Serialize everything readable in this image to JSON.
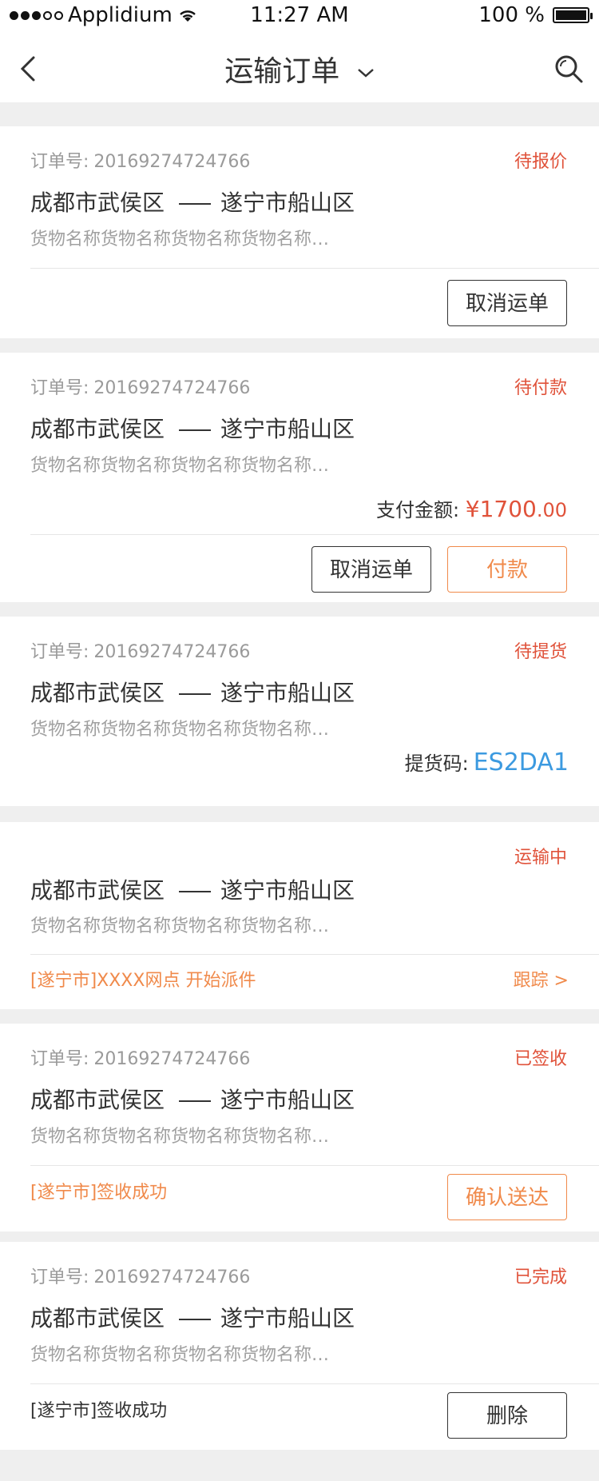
{
  "status_bar": {
    "carrier": "Applidium",
    "time": "11:27 AM",
    "battery": "100 %"
  },
  "nav": {
    "title": "运输订单"
  },
  "order_label": "订单号:",
  "orders": [
    {
      "order_no": "20169274724766",
      "status": "待报价",
      "route_from": "成都市武侯区",
      "route_to": "遂宁市船山区",
      "goods": "货物名称货物名称货物名称货物名称…",
      "buttons": {
        "cancel": "取消运单"
      }
    },
    {
      "order_no": "20169274724766",
      "status": "待付款",
      "route_from": "成都市武侯区",
      "route_to": "遂宁市船山区",
      "goods": "货物名称货物名称货物名称货物名称…",
      "amount_label": "支付金额:",
      "amount_int": "¥1700",
      "amount_dec": ".00",
      "buttons": {
        "cancel": "取消运单",
        "pay": "付款"
      }
    },
    {
      "order_no": "20169274724766",
      "status": "待提货",
      "route_from": "成都市武侯区",
      "route_to": "遂宁市船山区",
      "goods": "货物名称货物名称货物名称货物名称…",
      "pickup_label": "提货码:",
      "pickup_code": "ES2DA1"
    },
    {
      "status": "运输中",
      "route_from": "成都市武侯区",
      "route_to": "遂宁市船山区",
      "goods": "货物名称货物名称货物名称货物名称…",
      "tracking_text": "[遂宁市]XXXX网点 开始派件",
      "tracking_link": "跟踪 >"
    },
    {
      "order_no": "20169274724766",
      "status": "已签收",
      "route_from": "成都市武侯区",
      "route_to": "遂宁市船山区",
      "goods": "货物名称货物名称货物名称货物名称…",
      "sign_note": "[遂宁市]签收成功",
      "buttons": {
        "confirm": "确认送达"
      }
    },
    {
      "order_no": "20169274724766",
      "status": "已完成",
      "route_from": "成都市武侯区",
      "route_to": "遂宁市船山区",
      "goods": "货物名称货物名称货物名称货物名称…",
      "sign_note": "[遂宁市]签收成功",
      "buttons": {
        "delete": "删除"
      }
    }
  ],
  "colors": {
    "status_red": "#e0523a",
    "accent_orange": "#f08a4b",
    "code_blue": "#3c9ae0",
    "page_bg": "#efefef"
  }
}
